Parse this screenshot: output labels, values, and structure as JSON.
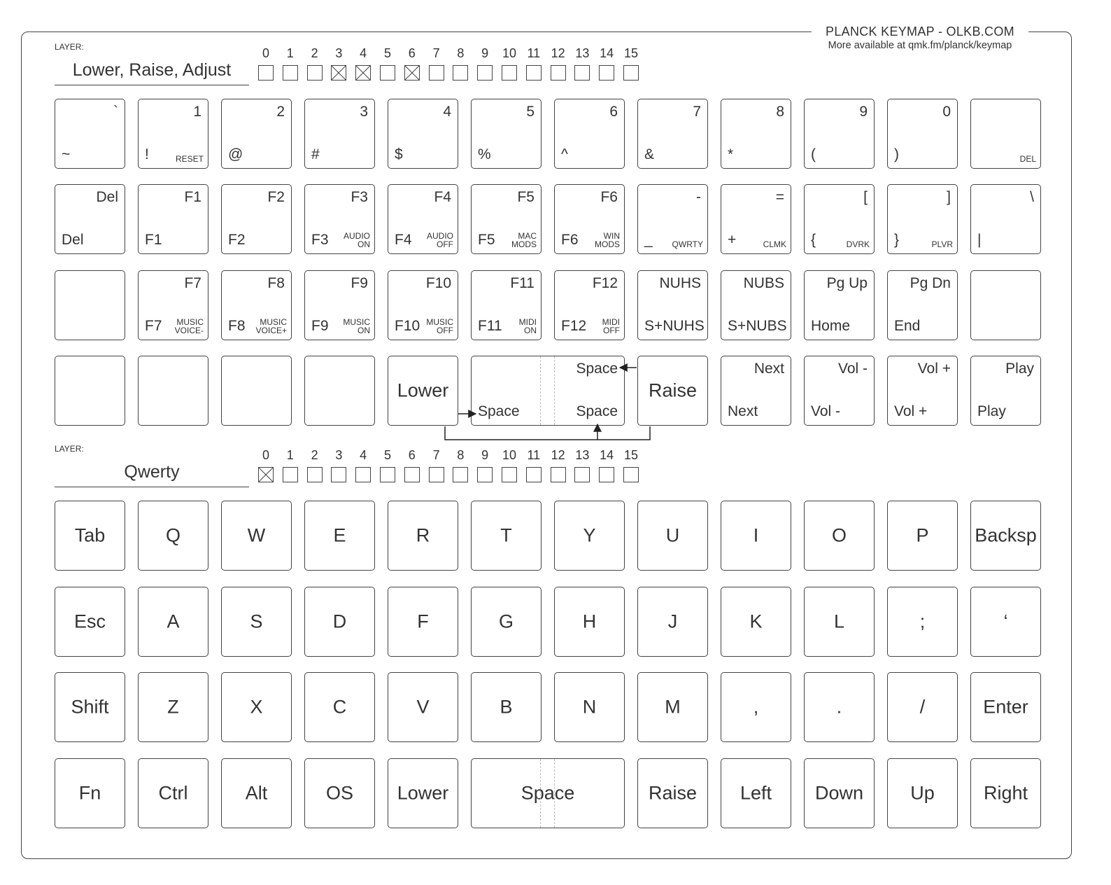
{
  "header": {
    "title": "PLANCK KEYMAP - OLKB.COM",
    "subtitle": "More available at qmk.fm/planck/keymap"
  },
  "layer_numbers": [
    "0",
    "1",
    "2",
    "3",
    "4",
    "5",
    "6",
    "7",
    "8",
    "9",
    "10",
    "11",
    "12",
    "13",
    "14",
    "15"
  ],
  "upper": {
    "layer_label": "LAYER:",
    "layer_name": "Lower, Raise, Adjust",
    "active_layers": [
      3,
      4,
      6
    ],
    "rows": [
      [
        {
          "tr": "`",
          "bl": "~",
          "br": ""
        },
        {
          "tr": "1",
          "bl": "!",
          "br": "RESET"
        },
        {
          "tr": "2",
          "bl": "@",
          "br": ""
        },
        {
          "tr": "3",
          "bl": "#",
          "br": ""
        },
        {
          "tr": "4",
          "bl": "$",
          "br": ""
        },
        {
          "tr": "5",
          "bl": "%",
          "br": ""
        },
        {
          "tr": "6",
          "bl": "^",
          "br": ""
        },
        {
          "tr": "7",
          "bl": "&",
          "br": ""
        },
        {
          "tr": "8",
          "bl": "*",
          "br": ""
        },
        {
          "tr": "9",
          "bl": "(",
          "br": ""
        },
        {
          "tr": "0",
          "bl": ")",
          "br": ""
        },
        {
          "tr": "",
          "bl": "",
          "br": "DEL"
        }
      ],
      [
        {
          "tr": "Del",
          "bl": "Del",
          "br": ""
        },
        {
          "tr": "F1",
          "bl": "F1",
          "br": ""
        },
        {
          "tr": "F2",
          "bl": "F2",
          "br": ""
        },
        {
          "tr": "F3",
          "bl": "F3",
          "br": "AUDIO\nON"
        },
        {
          "tr": "F4",
          "bl": "F4",
          "br": "AUDIO\nOFF"
        },
        {
          "tr": "F5",
          "bl": "F5",
          "br": "MAC\nMODS"
        },
        {
          "tr": "F6",
          "bl": "F6",
          "br": "WIN\nMODS"
        },
        {
          "tr": "-",
          "bl": "_",
          "br": "QWRTY"
        },
        {
          "tr": "=",
          "bl": "+",
          "br": "CLMK"
        },
        {
          "tr": "[",
          "bl": "{",
          "br": "DVRK"
        },
        {
          "tr": "]",
          "bl": "}",
          "br": "PLVR"
        },
        {
          "tr": "\\",
          "bl": "|",
          "br": ""
        }
      ],
      [
        {
          "tr": "",
          "bl": "",
          "br": ""
        },
        {
          "tr": "F7",
          "bl": "F7",
          "br": "MUSIC\nVOICE-"
        },
        {
          "tr": "F8",
          "bl": "F8",
          "br": "MUSIC\nVOICE+"
        },
        {
          "tr": "F9",
          "bl": "F9",
          "br": "MUSIC\nON"
        },
        {
          "tr": "F10",
          "bl": "F10",
          "br": "MUSIC\nOFF"
        },
        {
          "tr": "F11",
          "bl": "F11",
          "br": "MIDI\nON"
        },
        {
          "tr": "F12",
          "bl": "F12",
          "br": "MIDI\nOFF"
        },
        {
          "tr": "NUHS",
          "bl": "S+NUHS",
          "br": ""
        },
        {
          "tr": "NUBS",
          "bl": "S+NUBS",
          "br": ""
        },
        {
          "tr": "Pg Up",
          "bl": "Home",
          "br": ""
        },
        {
          "tr": "Pg Dn",
          "bl": "End",
          "br": ""
        },
        {
          "tr": "",
          "bl": "",
          "br": ""
        }
      ],
      [
        {
          "tr": "",
          "bl": "",
          "br": "",
          "ctr": ""
        },
        {
          "tr": "",
          "bl": "",
          "br": "",
          "ctr": ""
        },
        {
          "tr": "",
          "bl": "",
          "br": "",
          "ctr": ""
        },
        {
          "tr": "",
          "bl": "",
          "br": "",
          "ctr": ""
        },
        {
          "tr": "",
          "bl": "",
          "br": "",
          "ctr": "Lower"
        },
        {
          "tr": "Space",
          "bl": "Space",
          "br": "",
          "ctr": "",
          "br_big": "Space",
          "wide": true
        },
        {
          "tr": "",
          "bl": "",
          "br": "",
          "ctr": "Raise"
        },
        {
          "tr": "Next",
          "bl": "Next",
          "br": "",
          "ctr": ""
        },
        {
          "tr": "Vol -",
          "bl": "Vol -",
          "br": "",
          "ctr": ""
        },
        {
          "tr": "Vol +",
          "bl": "Vol +",
          "br": "",
          "ctr": ""
        },
        {
          "tr": "Play",
          "bl": "Play",
          "br": "",
          "ctr": ""
        }
      ]
    ]
  },
  "lower": {
    "layer_label": "LAYER:",
    "layer_name": "Qwerty",
    "active_layers": [
      0
    ],
    "rows": [
      [
        "Tab",
        "Q",
        "W",
        "E",
        "R",
        "T",
        "Y",
        "U",
        "I",
        "O",
        "P",
        "Backsp"
      ],
      [
        "Esc",
        "A",
        "S",
        "D",
        "F",
        "G",
        "H",
        "J",
        "K",
        "L",
        ";",
        "‘"
      ],
      [
        "Shift",
        "Z",
        "X",
        "C",
        "V",
        "B",
        "N",
        "M",
        ",",
        ".",
        "/",
        "Enter"
      ],
      [
        "Fn",
        "Ctrl",
        "Alt",
        "OS",
        "Lower",
        "Space",
        "Raise",
        "Left",
        "Down",
        "Up",
        "Right"
      ]
    ]
  }
}
